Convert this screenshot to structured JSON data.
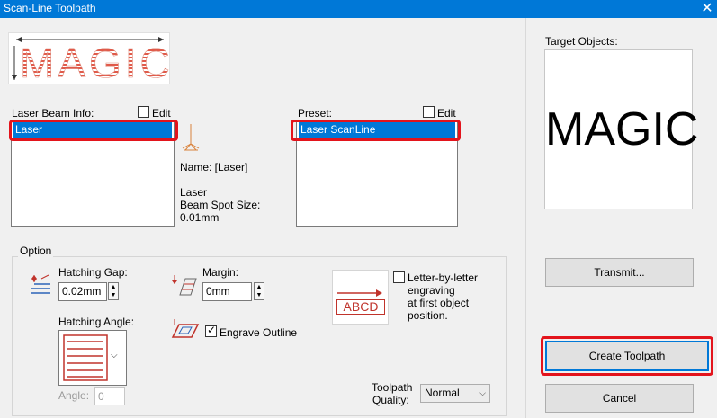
{
  "window": {
    "title": "Scan-Line Toolpath",
    "close_label": "✕"
  },
  "logo": {
    "text": "MAGIC"
  },
  "laser_beam": {
    "label": "Laser Beam Info:",
    "edit_label": "Edit",
    "edit_checked": false,
    "items": [
      "Laser"
    ],
    "name_label": "Name: [Laser]",
    "spot_line1": "Laser",
    "spot_line2": "Beam Spot Size:",
    "spot_value": "0.01mm"
  },
  "preset": {
    "label": "Preset:",
    "edit_label": "Edit",
    "edit_checked": false,
    "items": [
      "Laser ScanLine"
    ]
  },
  "option": {
    "group_label": "Option",
    "hatching_gap_label": "Hatching Gap:",
    "hatching_gap_value": "0.02mm",
    "margin_label": "Margin:",
    "margin_value": "0mm",
    "hatching_angle_label": "Hatching Angle:",
    "angle_label": "Angle:",
    "angle_value": "0",
    "engrave_outline_label": "Engrave Outline",
    "engrave_outline_checked": true,
    "abcd_text": "ABCD",
    "letter_line1": "Letter-by-letter",
    "letter_line2": "engraving",
    "letter_line3": "at first object",
    "letter_line4": "position.",
    "letter_checked": false,
    "quality_line1": "Toolpath",
    "quality_line2": "Quality:",
    "quality_value": "Normal"
  },
  "right": {
    "target_label": "Target Objects:",
    "target_text": "MAGIC",
    "transmit_label": "Transmit...",
    "create_label": "Create Toolpath",
    "cancel_label": "Cancel"
  },
  "colors": {
    "accent": "#0078d7",
    "highlight_red": "#e3141c",
    "logo_red": "#e05a4a"
  }
}
